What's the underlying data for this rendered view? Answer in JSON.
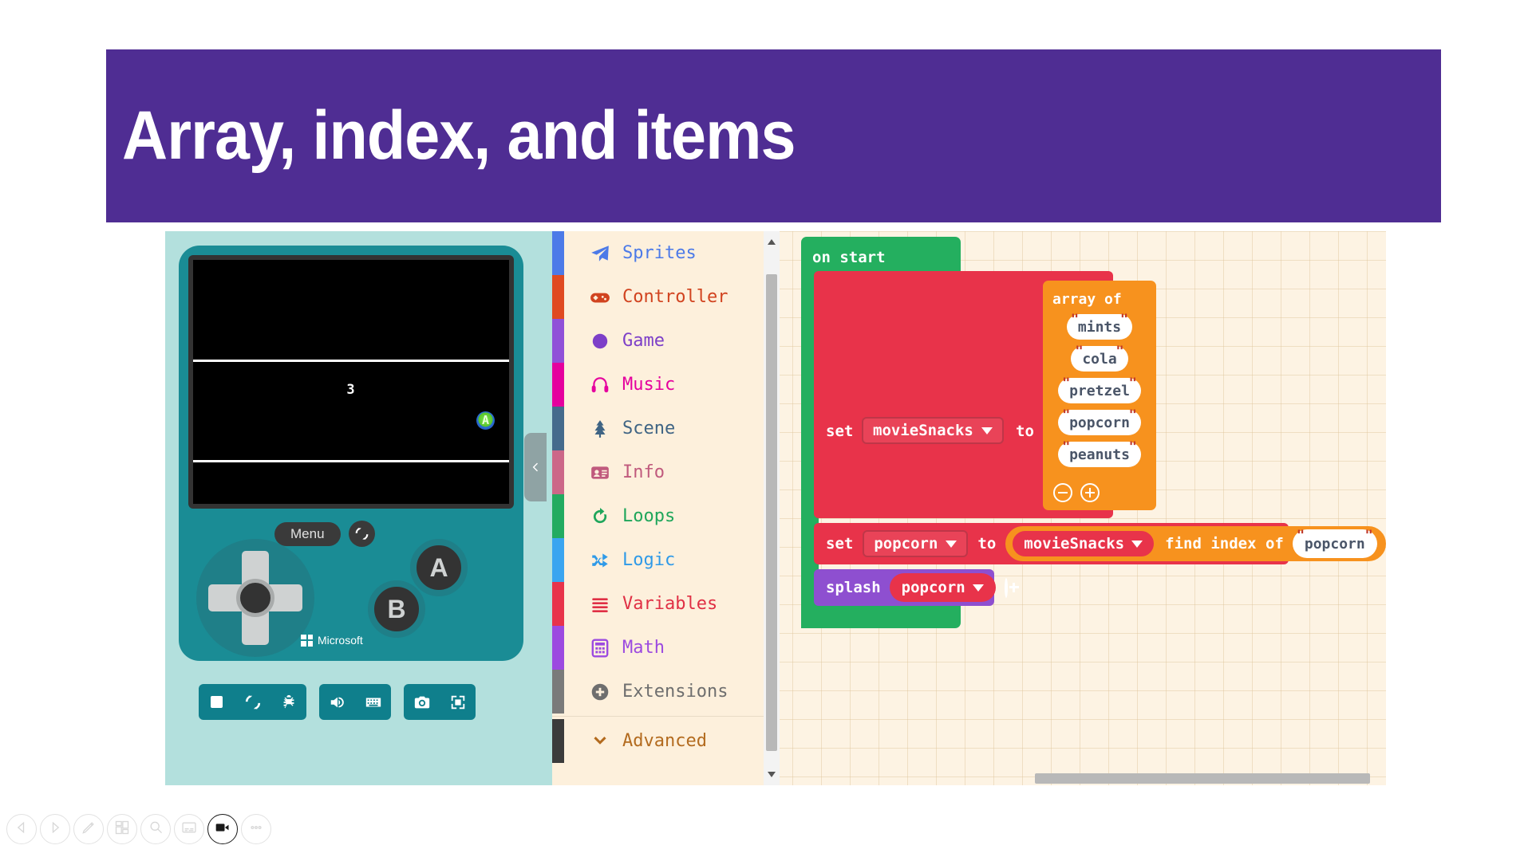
{
  "slide": {
    "title": "Array, index, and items",
    "banner_color": "#4F2D93"
  },
  "simulator": {
    "screen": {
      "splash_value": "3",
      "sprite_label": "A"
    },
    "menu_button": "Menu",
    "restart_icon": "restart-icon",
    "dpad_icon": "dpad-icon",
    "button_a": "A",
    "button_b": "B",
    "brand": "Microsoft",
    "toolbar": [
      {
        "name": "stop-button",
        "icon": "stop-icon"
      },
      {
        "name": "restart-button",
        "icon": "restart-icon"
      },
      {
        "name": "debug-button",
        "icon": "bug-icon"
      },
      {
        "name": "sound-button",
        "icon": "speaker-icon"
      },
      {
        "name": "keyboard-button",
        "icon": "keyboard-icon"
      },
      {
        "name": "screenshot-button",
        "icon": "camera-icon"
      },
      {
        "name": "fullscreen-button",
        "icon": "fullscreen-icon"
      }
    ],
    "collapse_icon": "chevron-left-icon"
  },
  "toolbox": {
    "categories": [
      {
        "label": "Sprites",
        "color": "#4c7ae8",
        "text_color": "#4c7ae8",
        "icon": "paper-plane-icon"
      },
      {
        "label": "Controller",
        "color": "#e04a21",
        "text_color": "#d1431f",
        "icon": "gamepad-icon"
      },
      {
        "label": "Game",
        "color": "#9050d8",
        "text_color": "#7d3fc8",
        "icon": "circle-icon"
      },
      {
        "label": "Music",
        "color": "#e5009e",
        "text_color": "#e5009e",
        "icon": "headphones-icon"
      },
      {
        "label": "Scene",
        "color": "#456b8c",
        "text_color": "#3f6484",
        "icon": "tree-icon"
      },
      {
        "label": "Info",
        "color": "#cc6788",
        "text_color": "#c05a7d",
        "icon": "id-card-icon"
      },
      {
        "label": "Loops",
        "color": "#22ab60",
        "text_color": "#1fa65b",
        "icon": "loop-arrow-icon"
      },
      {
        "label": "Logic",
        "color": "#3aa5f0",
        "text_color": "#2f9ae8",
        "icon": "shuffle-icon"
      },
      {
        "label": "Variables",
        "color": "#e8334a",
        "text_color": "#e03045",
        "icon": "lines-icon"
      },
      {
        "label": "Math",
        "color": "#9c4ae0",
        "text_color": "#9c4ae0",
        "icon": "calculator-icon"
      },
      {
        "label": "Extensions",
        "color": "#7a7a7a",
        "text_color": "#6e6e6e",
        "icon": "plus-circle-icon"
      },
      {
        "label": "Advanced",
        "color": "#3b3b3b",
        "text_color": "#b36b1f",
        "icon": "chevron-down-icon"
      }
    ]
  },
  "workspace": {
    "on_start_label": "on start",
    "set_keyword": "set",
    "to_keyword": "to",
    "array_variable": "movieSnacks",
    "array_block_title": "array of",
    "array_items": [
      "mints",
      "cola",
      "pretzel",
      "popcorn",
      "peanuts"
    ],
    "array_remove_icon": "minus-circle-icon",
    "array_add_icon": "plus-circle-icon",
    "index_variable": "popcorn",
    "find_index_label": "find index of",
    "find_index_argument": "popcorn",
    "splash_label": "splash",
    "splash_variable": "popcorn",
    "splash_add_icon": "plus-circle-icon",
    "colors": {
      "on_start": "#24af5f",
      "variables": "#e8334a",
      "arrays": "#f7921e",
      "game": "#8e4fd0"
    }
  },
  "presentation_controls": [
    {
      "name": "previous-slide-button",
      "icon": "triangle-left-icon",
      "active": false
    },
    {
      "name": "next-slide-button",
      "icon": "triangle-right-icon",
      "active": false
    },
    {
      "name": "pen-tool-button",
      "icon": "pen-icon",
      "active": false
    },
    {
      "name": "all-slides-button",
      "icon": "grid-icon",
      "active": false
    },
    {
      "name": "zoom-button",
      "icon": "magnifier-icon",
      "active": false
    },
    {
      "name": "subtitles-button",
      "icon": "subtitles-icon",
      "active": false
    },
    {
      "name": "camera-button",
      "icon": "video-camera-icon",
      "active": true
    },
    {
      "name": "more-options-button",
      "icon": "ellipsis-icon",
      "active": false
    }
  ]
}
